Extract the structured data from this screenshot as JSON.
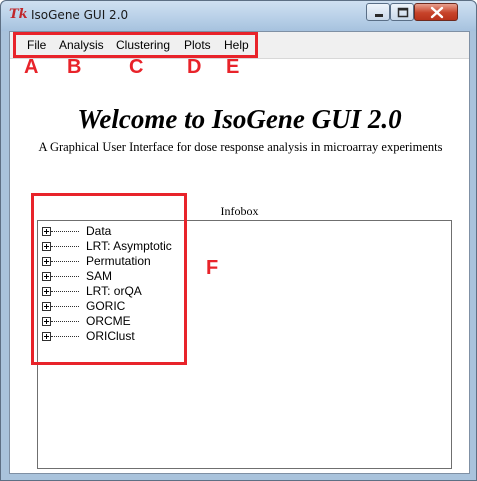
{
  "window": {
    "title": "IsoGene GUI 2.0",
    "app_icon": "Tk"
  },
  "menubar": {
    "items": [
      {
        "label": "File"
      },
      {
        "label": "Analysis"
      },
      {
        "label": "Clustering"
      },
      {
        "label": "Plots"
      },
      {
        "label": "Help"
      }
    ]
  },
  "annotations": {
    "letters": [
      "A",
      "B",
      "C",
      "D",
      "E",
      "F"
    ],
    "color": "#e8232a"
  },
  "main": {
    "welcome_title": "Welcome to IsoGene GUI 2.0",
    "subtitle": "A Graphical User Interface for dose response analysis in microarray experiments",
    "infobox_label": "Infobox"
  },
  "tree": {
    "items": [
      {
        "label": "Data"
      },
      {
        "label": "LRT: Asymptotic"
      },
      {
        "label": "Permutation"
      },
      {
        "label": "SAM"
      },
      {
        "label": "LRT: orQA"
      },
      {
        "label": "GORIC"
      },
      {
        "label": "ORCME"
      },
      {
        "label": "ORIClust"
      }
    ]
  }
}
